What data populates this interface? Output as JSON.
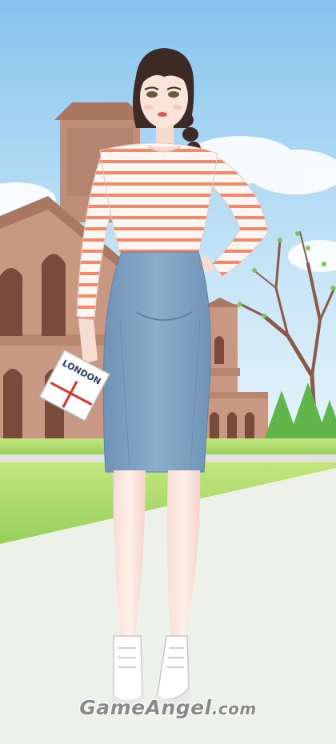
{
  "scene": {
    "description_colors": {
      "sky_top": "#8ec9ef",
      "sky_bottom": "#d9eef9",
      "building": "#c08e78",
      "building_shadow": "#9c6c5a",
      "lawn": "#a9d86a",
      "path": "#eef0ea",
      "shirt_stripe": "#f08a6a",
      "skirt": "#7fa2c3"
    }
  },
  "prop": {
    "booklet_text": "LONDON"
  },
  "watermark": {
    "main": "GameAngel",
    "tld": ".com"
  }
}
